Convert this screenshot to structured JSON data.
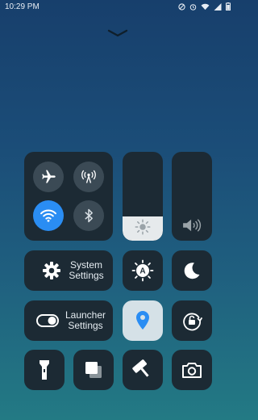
{
  "status_bar": {
    "time": "10:29 PM",
    "icons": [
      "do-not-disturb-icon",
      "alarm-icon",
      "wifi-icon",
      "signal-icon",
      "battery-icon"
    ]
  },
  "connectivity": {
    "airplane": {
      "icon": "airplane-icon",
      "active": false
    },
    "hotspot": {
      "icon": "hotspot-icon",
      "active": false
    },
    "wifi": {
      "icon": "wifi-icon",
      "active": true
    },
    "bluetooth": {
      "icon": "bluetooth-icon",
      "active": false
    }
  },
  "brightness": {
    "icon": "sun-icon",
    "level": 0.27
  },
  "volume": {
    "icon": "speaker-icon",
    "level": 0.0
  },
  "system_settings": {
    "line1": "System",
    "line2": "Settings",
    "icon": "gear-icon"
  },
  "launcher_settings": {
    "line1": "Launcher",
    "line2": "Settings",
    "icon": "toggle-icon"
  },
  "auto_brightness": {
    "icon": "auto-brightness-icon",
    "letter": "A"
  },
  "night_mode": {
    "icon": "moon-icon"
  },
  "location": {
    "icon": "location-pin-icon",
    "active": true
  },
  "rotation_lock": {
    "icon": "rotation-lock-icon"
  },
  "flashlight": {
    "icon": "flashlight-icon"
  },
  "multitask": {
    "icon": "recent-apps-icon"
  },
  "paint": {
    "icon": "paint-roller-icon"
  },
  "camera": {
    "icon": "camera-icon"
  },
  "colors": {
    "accent": "#2a8df3",
    "tile": "#1c2a34",
    "button": "#3b4a55",
    "tile_light": "#d5e1e7"
  }
}
